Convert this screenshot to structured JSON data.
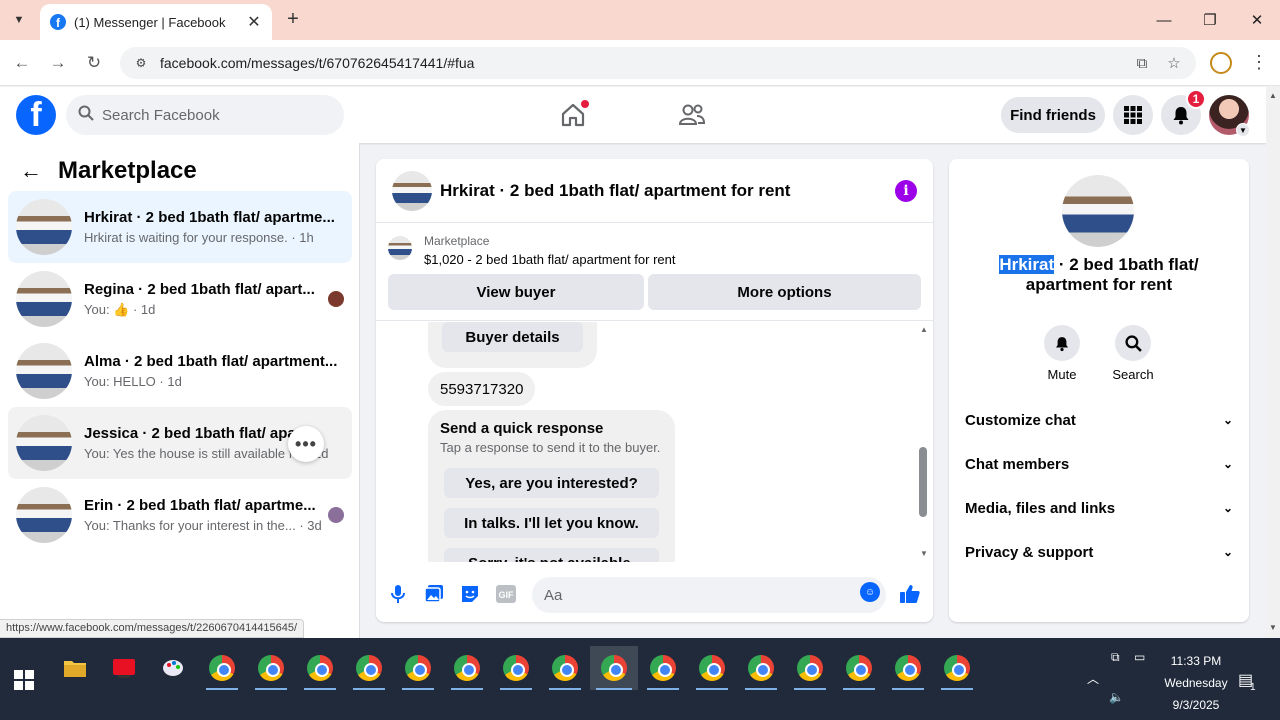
{
  "browser": {
    "tab_title": "(1) Messenger | Facebook",
    "url": "facebook.com/messages/t/670762645417441/#fua",
    "status_url": "https://www.facebook.com/messages/t/2260670414415645/"
  },
  "header": {
    "search_placeholder": "Search Facebook",
    "find_friends": "Find friends",
    "notification_count": "1"
  },
  "left": {
    "title": "Marketplace",
    "conversations": [
      {
        "name": "Hrkirat · 2 bed 1bath flat/ apartme...",
        "snippet": "Hrkirat is waiting for your response. · 1h"
      },
      {
        "name": "Regina · 2 bed 1bath flat/ apart...",
        "snippet_prefix": "You: ",
        "snippet_suffix": " · 1d"
      },
      {
        "name": "Alma · 2 bed 1bath flat/ apartment...",
        "snippet": "You: HELLO · 1d"
      },
      {
        "name": "Jessica · 2 bed 1bath flat/ apart...",
        "snippet": "You: Yes the house is still available fo... 2d"
      },
      {
        "name": "Erin · 2 bed 1bath flat/ apartme...",
        "snippet": "You: Thanks for your interest in the... · 3d"
      }
    ]
  },
  "chat": {
    "title": "Hrkirat · 2 bed 1bath flat/ apartment for rent",
    "marketplace_label": "Marketplace",
    "listing_price": "$1,020 - 2 bed 1bath flat/ apartment for rent",
    "view_buyer": "View buyer",
    "more_options": "More options",
    "buyer_details": "Buyer details",
    "phone": "5593717320",
    "quick_title": "Send a quick response",
    "quick_subtitle": "Tap a response to send it to the buyer.",
    "quick_responses": [
      "Yes, are you interested?",
      "In talks. I'll let you know.",
      "Sorry, it's not available."
    ],
    "input_placeholder": "Aa"
  },
  "right": {
    "title_highlight": "Hrkirat",
    "title_rest_line1": " · 2 bed 1bath flat/",
    "title_line2": "apartment for rent",
    "mute": "Mute",
    "search": "Search",
    "sections": [
      "Customize chat",
      "Chat members",
      "Media, files and links",
      "Privacy & support"
    ]
  },
  "taskbar": {
    "time": "11:33 PM",
    "day": "Wednesday",
    "date": "9/3/2025",
    "action_center_count": "1"
  },
  "colors": {
    "fb_blue": "#0866ff",
    "badge_red": "#e41e3f",
    "info_purple": "#9b00e8",
    "taskbar_bg": "#202a3a",
    "tab_strip": "#f9d9cf"
  }
}
